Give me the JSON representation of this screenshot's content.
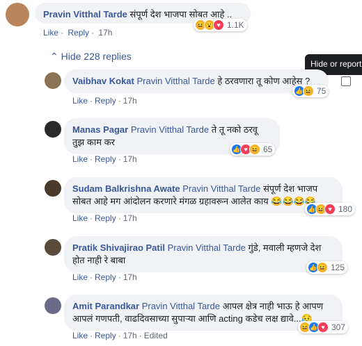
{
  "top_comment": {
    "author": "Pravin Vitthal Tarde",
    "text": "संपूर्ण देश भाजपा सोबत आहे ..",
    "like": "Like",
    "reply": "Reply",
    "time": "17h",
    "reaction_count": "1.1K"
  },
  "hide_replies": "Hide 228 replies",
  "tooltip": "Hide or report this",
  "replies": [
    {
      "author": "Vaibhav Kokat",
      "mention": "Pravin Vitthal Tarde",
      "text": "हे ठरवणारा तू कोण आहेस ?",
      "time": "17h",
      "count": "75",
      "edited": ""
    },
    {
      "author": "Manas Pagar",
      "mention": "Pravin Vitthal Tarde",
      "text": "ते तू नको ठरवू तुझ काम कर",
      "time": "17h",
      "count": "65",
      "edited": ""
    },
    {
      "author": "Sudam Balkrishna Awate",
      "mention": "Pravin Vitthal Tarde",
      "text": "संपूर्ण देश भाजप सोबत आहे मग आंदोलन करणारे मंगळ ग्रहावरून आलेत काय 😂😂😂😂",
      "time": "17h",
      "count": "180",
      "edited": ""
    },
    {
      "author": "Pratik Shivajirao Patil",
      "mention": "Pravin Vitthal Tarde",
      "text": "गुंडे, मवाली म्हणजे देश होत नाही रे बाबा",
      "time": "17h",
      "count": "125",
      "edited": ""
    },
    {
      "author": "Amit Parandkar",
      "mention": "Pravin Vitthal Tarde",
      "text": "आपल क्षेत्र नाही भाऊ हे आपण आपलं गणपती, वाढदिवसाच्या सुपाऱ्या आणि acting कडेच लक्ष द्यावे...😥",
      "time": "17h",
      "count": "307",
      "edited": "Edited"
    }
  ],
  "labels": {
    "like": "Like",
    "reply": "Reply"
  }
}
